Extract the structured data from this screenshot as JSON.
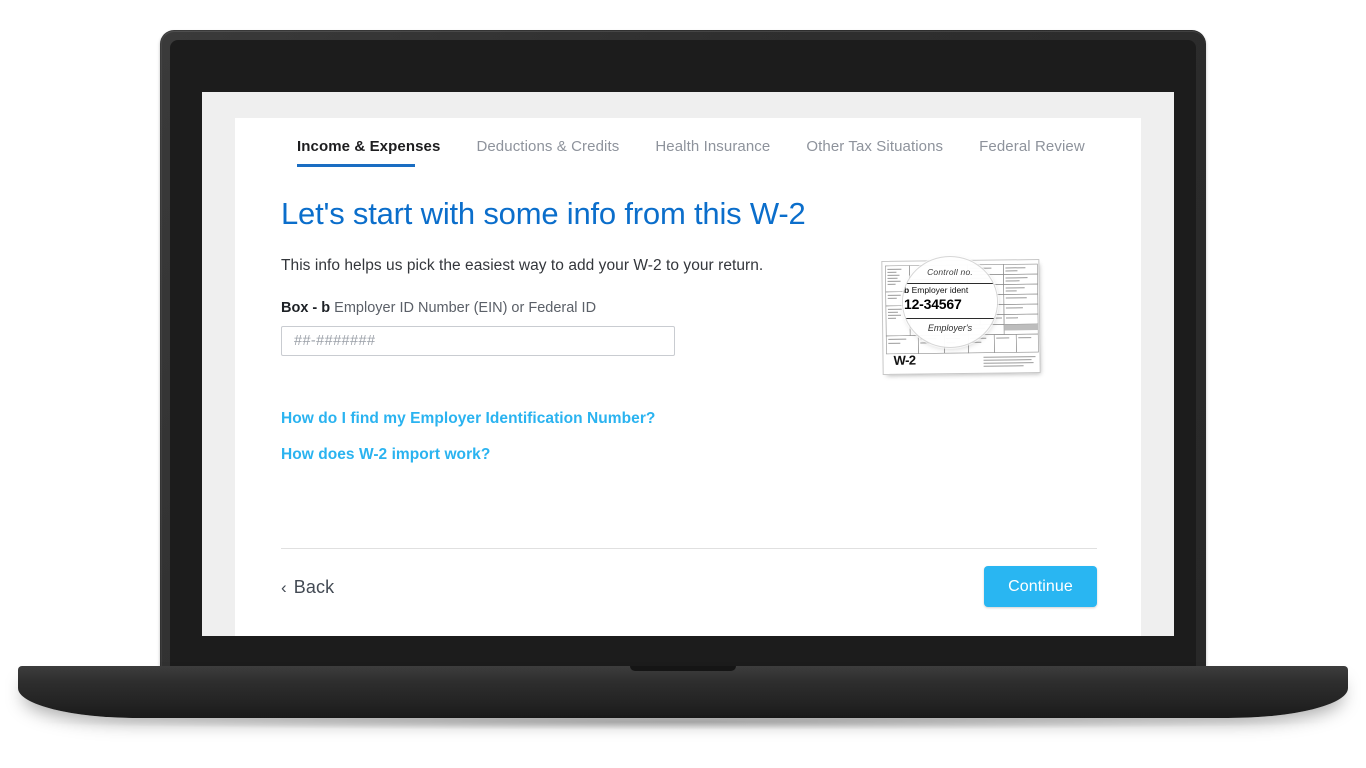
{
  "device": {
    "type": "laptop"
  },
  "tabs": [
    {
      "label": "Income & Expenses",
      "active": true
    },
    {
      "label": "Deductions & Credits",
      "active": false
    },
    {
      "label": "Health Insurance",
      "active": false
    },
    {
      "label": "Other Tax Situations",
      "active": false
    },
    {
      "label": "Federal Review",
      "active": false
    }
  ],
  "main": {
    "title": "Let's start with some info from this W-2",
    "intro": "This info helps us pick the easiest way to add your W-2 to your return.",
    "field": {
      "label_bold": "Box - b",
      "label_rest": " Employer ID Number (EIN) or Federal ID",
      "value": "",
      "placeholder": "##-#######"
    },
    "help_links": [
      "How do I find my Employer Identification Number?",
      "How does W-2 import work?"
    ]
  },
  "w2_image": {
    "form_name": "W-2",
    "lens_top_text": "Controll no.",
    "lens_box_caption_bold": "b",
    "lens_box_caption": "Employer ident",
    "lens_box_value": "12-34567",
    "lens_bottom_text": "Employer's"
  },
  "footer": {
    "back_label": "Back",
    "back_chevron": "‹",
    "continue_label": "Continue"
  },
  "colors": {
    "title_blue": "#0b6ecb",
    "link_blue": "#2ab3f0",
    "tab_underline": "#1a6dc2",
    "continue_bg": "#29b6f2",
    "screen_bg": "#efefef",
    "card_bg": "#ffffff",
    "bezel": "#2f2f2f"
  }
}
